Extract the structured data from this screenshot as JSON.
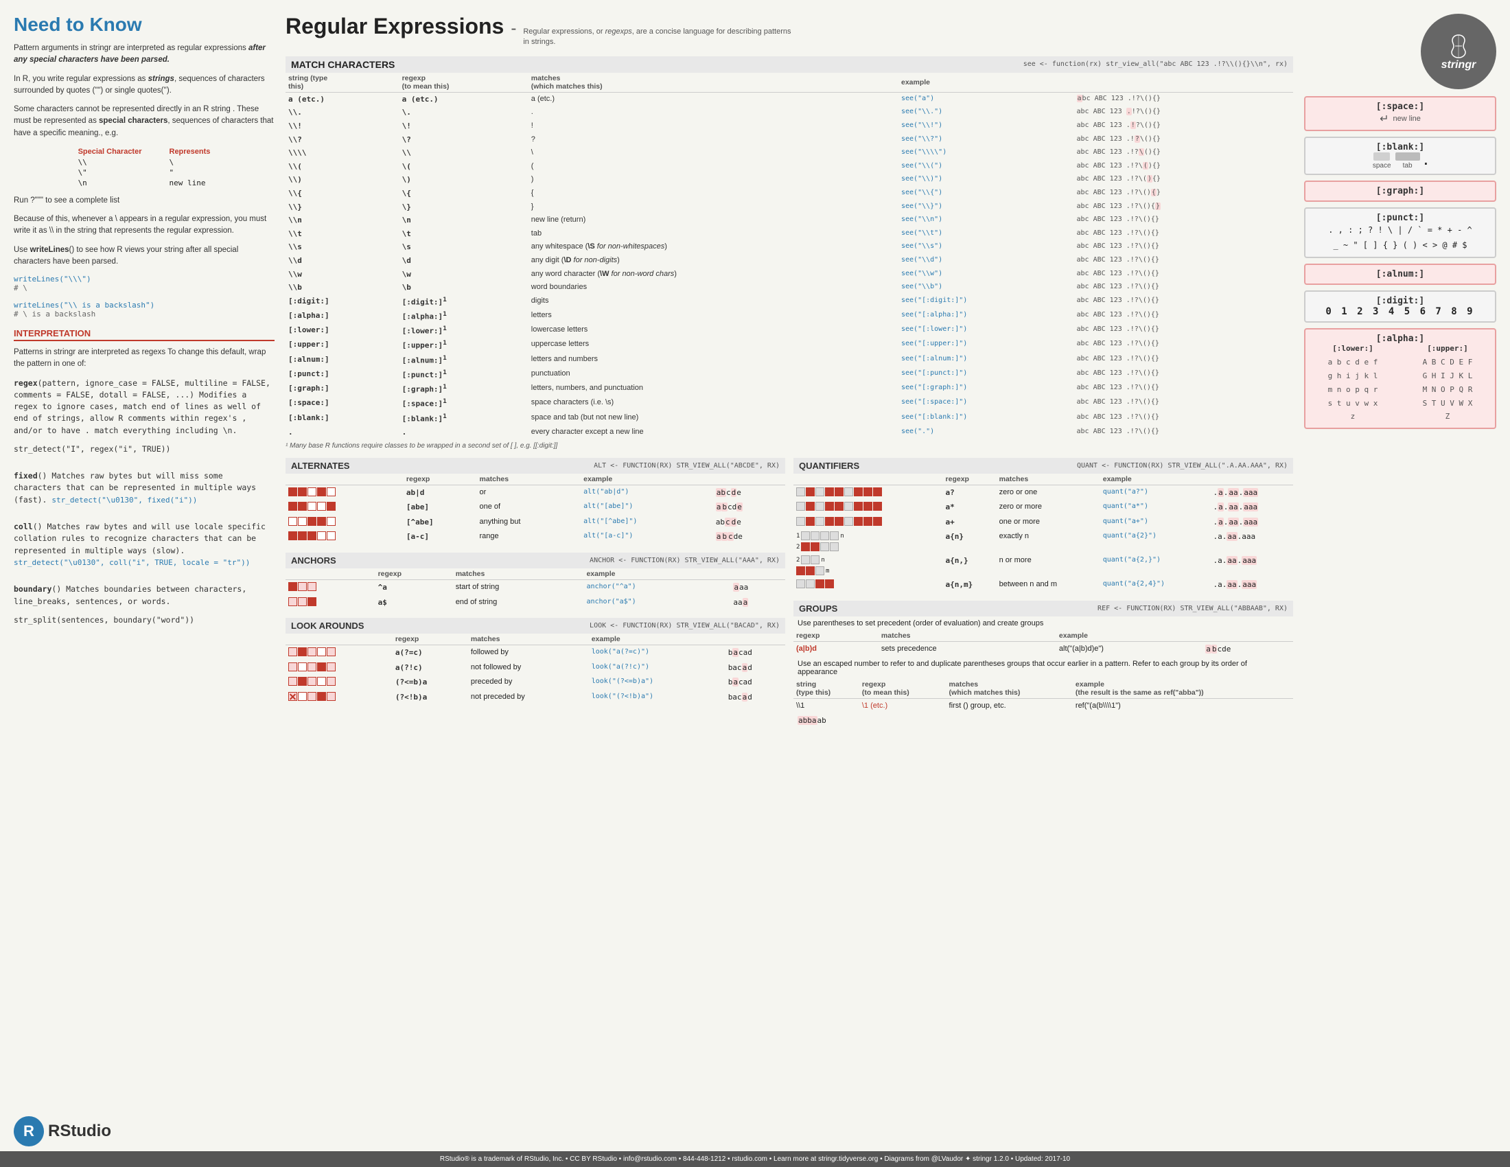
{
  "left": {
    "title": "Need to Know",
    "para1": "Pattern arguments in stringr are interpreted as regular expressions after any special characters have been parsed.",
    "para2": "In R, you write regular expressions as strings, sequences of characters surrounded by quotes (\"\") or single quotes('').",
    "para3": "Some characters cannot be represented directly in an R string . These must be represented as special characters, sequences of characters that have a specific meaning., e.g.",
    "special_chars_header": [
      "Special Character",
      "Represents"
    ],
    "special_chars": [
      {
        "char": "\\\\",
        "rep": "\\"
      },
      {
        "char": "\\\"",
        "rep": "\""
      },
      {
        "char": "\\n",
        "rep": "new line"
      }
    ],
    "run_code": "Run ?\"\"\" to see a complete list",
    "para4": "Because of this, whenever a \\ appears in a regular expression, you must write it as \\\\ in the string that represents the regular expression.",
    "para5": "Use writeLines() to see how R views your string after all special characters have been parsed.",
    "code1": "writeLines(\"\\\\\")\n# \\",
    "code2": "writeLines(\"\\\\ is a backslash\")\n# \\ is a backslash",
    "interpretation_title": "INTERPRETATION",
    "interp_para": "Patterns in stringr are interpreted as regexs To change this default, wrap the pattern in one of:",
    "regex_text": "regex(pattern, ignore_case = FALSE, multiline = FALSE, comments = FALSE, dotall = FALSE, ...) Modifies a regex to ignore cases, match end of lines as well of end of strings, allow R comments within regex's , and/or to have . match everything including \\n.\nstr_detect(\"I\", regex(\"i\", TRUE))",
    "fixed_text": "fixed() Matches raw bytes but will miss some characters that can be represented in multiple ways (fast). str_detect(\"\\u0130\", fixed(\"i\"))",
    "coll_text": "coll() Matches raw bytes and will use locale specific collation rules to recognize characters that can be represented in multiple ways (slow). str_detect(\"\\u0130\", coll(\"i\", TRUE, locale = \"tr\"))",
    "boundary_text": "boundary() Matches boundaries between characters, line_breaks, sentences, or words.\nstr_split(sentences, boundary(\"word\"))"
  },
  "middle": {
    "title": "Regular Expressions",
    "dash": "-",
    "subtitle": "Regular expressions, or regexps, are a concise language for describing patterns in strings.",
    "match_chars": {
      "header": "MATCH CHARACTERS",
      "see_fn": "see <- function(rx) str_view_all(\"abc ABC 123 .!?\\\\(){}\\n\", rx)",
      "col_headers": [
        "string (type this)",
        "regexp (to mean this)",
        "matches (which matches this)",
        "example"
      ],
      "rows": [
        {
          "string": "a (etc.)",
          "regexp": "a (etc.)",
          "matches": "a (etc.)",
          "see": "see(\"a\")",
          "example": "abc ABC 123 .!?\\(){}"
        },
        {
          "string": "\\\\.",
          "regexp": "\\.",
          "matches": ".",
          "see": "see(\"\\\\.\")",
          "example": "abc ABC 123 .!?\\(){}"
        },
        {
          "string": "\\\\!",
          "regexp": "\\!",
          "matches": "!",
          "see": "see(\"\\\\!\")",
          "example": "abc ABC 123 .!?\\(){}"
        },
        {
          "string": "\\\\?",
          "regexp": "\\?",
          "matches": "?",
          "see": "see(\"\\\\?\")",
          "example": "abc ABC 123 .!?\\(){}"
        },
        {
          "string": "\\\\\\\\",
          "regexp": "\\\\",
          "matches": "\\",
          "see": "see(\"\\\\\\\\\")",
          "example": "abc ABC 123 .!?\\(){}"
        },
        {
          "string": "\\\\(",
          "regexp": "\\(",
          "matches": "(",
          "see": "see(\"\\\\(\")",
          "example": "abc ABC 123 .!?\\(){}"
        },
        {
          "string": "\\\\)",
          "regexp": "\\)",
          "matches": ")",
          "see": "see(\"\\\\)\")",
          "example": "abc ABC 123 .!?\\(){}"
        },
        {
          "string": "\\\\{",
          "regexp": "\\{",
          "matches": "{",
          "see": "see(\"\\\\{\")",
          "example": "abc ABC 123 .!?\\(){}"
        },
        {
          "string": "\\\\}",
          "regexp": "\\}",
          "matches": "}",
          "see": "see(\"\\\\}\")",
          "example": "abc ABC 123 .!?\\(){}"
        },
        {
          "string": "\\\\n",
          "regexp": "\\n",
          "matches": "new line (return)",
          "see": "see(\"\\\\n\")",
          "example": "abc ABC 123 .!?\\(){}"
        },
        {
          "string": "\\\\t",
          "regexp": "\\t",
          "matches": "tab",
          "see": "see(\"\\\\t\")",
          "example": "abc ABC 123 .!?\\(){}"
        },
        {
          "string": "\\\\s",
          "regexp": "\\s",
          "matches": "any whitespace (\\S for non-whitespaces)",
          "see": "see(\"\\\\s\")",
          "example": "abc ABC 123 .!?\\(){}"
        },
        {
          "string": "\\\\d",
          "regexp": "\\d",
          "matches": "any digit (\\D for non-digits)",
          "see": "see(\"\\\\d\")",
          "example": "abc ABC 123 .!?\\(){}"
        },
        {
          "string": "\\\\w",
          "regexp": "\\w",
          "matches": "any word character (\\W for non-word chars)",
          "see": "see(\"\\\\w\")",
          "example": "abc ABC 123 .!?\\(){}"
        },
        {
          "string": "\\\\b",
          "regexp": "\\b",
          "matches": "word boundaries",
          "see": "see(\"\\\\b\")",
          "example": "abc ABC 123 .!?\\(){}"
        },
        {
          "string": "[:digit:]",
          "regexp": "[:digit:]",
          "matches": "digits",
          "see": "see(\"[:digit:]\")",
          "example": "abc ABC 123 .!?\\(){}"
        },
        {
          "string": "[:alpha:]",
          "regexp": "[:alpha:]",
          "matches": "letters",
          "see": "see(\"[:alpha:]\")",
          "example": "abc ABC 123 .!?\\(){}"
        },
        {
          "string": "[:lower:]",
          "regexp": "[:lower:]",
          "matches": "lowercase letters",
          "see": "see(\"[:lower:]\")",
          "example": "abc ABC 123 .!?\\(){}"
        },
        {
          "string": "[:upper:]",
          "regexp": "[:upper:]",
          "matches": "uppercase letters",
          "see": "see(\"[:upper:]\")",
          "example": "abc ABC 123 .!?\\(){}"
        },
        {
          "string": "[:alnum:]",
          "regexp": "[:alnum:]",
          "matches": "letters and numbers",
          "see": "see(\"[:alnum:]\")",
          "example": "abc ABC 123 .!?\\(){}"
        },
        {
          "string": "[:punct:]",
          "regexp": "[:punct:]",
          "matches": "punctuation",
          "see": "see(\"[:punct:]\")",
          "example": "abc ABC 123 .!?\\(){}"
        },
        {
          "string": "[:graph:]",
          "regexp": "[:graph:]",
          "matches": "letters, numbers, and punctuation",
          "see": "see(\"[:graph:]\")",
          "example": "abc ABC 123 .!?\\(){}"
        },
        {
          "string": "[:space:]",
          "regexp": "[:space:]",
          "matches": "space characters (i.e. \\s)",
          "see": "see(\"[:space:]\")",
          "example": "abc ABC 123 .!?\\(){}"
        },
        {
          "string": "[:blank:]",
          "regexp": "[:blank:]",
          "matches": "space and tab (but not new line)",
          "see": "see(\"[:blank:]\")",
          "example": "abc ABC 123 .!?\\(){}"
        },
        {
          "string": ".",
          "regexp": ".",
          "matches": "every character except a new line",
          "see": "see(\".\")",
          "example": "abc ABC 123 .!?\\(){}"
        }
      ],
      "footnote": "¹ Many base R functions require classes to be wrapped in a second set of [ ], e.g. [[:digit:]]"
    },
    "alternates": {
      "header": "ALTERNATES",
      "see_fn": "alt <- function(rx) str_view_all(\"abcde\", rx)",
      "col_headers": [
        "regexp",
        "matches",
        "example",
        ""
      ],
      "rows": [
        {
          "regexp": "ab|d",
          "matches": "or",
          "example_fn": "alt(\"ab|d\")",
          "result": "abcde"
        },
        {
          "regexp": "[abe]",
          "matches": "one of",
          "example_fn": "alt(\"[abe]\")",
          "result": "abcde"
        },
        {
          "regexp": "[^abe]",
          "matches": "anything but",
          "example_fn": "alt(\"[^abe]\")",
          "result": "abcde"
        },
        {
          "regexp": "[a-c]",
          "matches": "range",
          "example_fn": "alt(\"[a-c]\")",
          "result": "abcde"
        }
      ]
    },
    "anchors": {
      "header": "ANCHORS",
      "see_fn": "anchor <- function(rx) str_view_all(\"aaa\", rx)",
      "col_headers": [
        "regexp",
        "matches",
        "example",
        ""
      ],
      "rows": [
        {
          "regexp": "^a",
          "matches": "start of string",
          "example_fn": "anchor(\"^a\")",
          "result": "aaa"
        },
        {
          "regexp": "a$",
          "matches": "end of string",
          "example_fn": "anchor(\"a$\")",
          "result": "aaa"
        }
      ]
    },
    "lookarounds": {
      "header": "LOOK AROUNDS",
      "see_fn": "look <- function(rx) str_view_all(\"bacad\", rx)",
      "col_headers": [
        "regexp",
        "matches",
        "example",
        ""
      ],
      "rows": [
        {
          "regexp": "a(?=c)",
          "matches": "followed by",
          "example_fn": "look(\"a(?=c)\")",
          "result": "bacad"
        },
        {
          "regexp": "a(?!c)",
          "matches": "not followed by",
          "example_fn": "look(\"a(?!c)\")",
          "result": "bacad"
        },
        {
          "regexp": "(?<=b)a",
          "matches": "preceded by",
          "example_fn": "look(\"(?<=b)a\")",
          "result": "bacad"
        },
        {
          "regexp": "(?<!b)a",
          "matches": "not preceded by",
          "example_fn": "look(\"(?<!b)a\")",
          "result": "bacad"
        }
      ]
    },
    "quantifiers": {
      "header": "QUANTIFIERS",
      "see_fn": "quant <- function(rx) str_view_all(\".a.aa.aaa\", rx)",
      "col_headers": [
        "regexp",
        "matches",
        "example",
        ""
      ],
      "rows": [
        {
          "regexp": "a?",
          "matches": "zero or one",
          "example_fn": "quant(\"a?\")",
          "result": ".a.aa.aaa"
        },
        {
          "regexp": "a*",
          "matches": "zero or more",
          "example_fn": "quant(\"a*\")",
          "result": ".a.aa.aaa"
        },
        {
          "regexp": "a+",
          "matches": "one or more",
          "example_fn": "quant(\"a+\")",
          "result": ".a.aa.aaa"
        },
        {
          "regexp": "a{n}",
          "matches": "exactly n",
          "example_fn": "quant(\"a{2}\")",
          "result": ".a.aa.aaa"
        },
        {
          "regexp": "a{n,}",
          "matches": "n or more",
          "example_fn": "quant(\"a{2,}\")",
          "result": ".a.aa.aaa"
        },
        {
          "regexp": "a{n,m}",
          "matches": "between n and m",
          "example_fn": "quant(\"a{2,4}\")",
          "result": ".a.aa.aaa"
        }
      ]
    },
    "groups": {
      "header": "GROUPS",
      "see_fn": "ref <- function(rx) str_view_all(\"abbaab\", rx)",
      "desc": "Use parentheses to set precedent (order of evaluation) and create groups",
      "col_headers": [
        "regexp",
        "matches",
        "example"
      ],
      "rows": [
        {
          "regexp": "(a|b)d",
          "matches": "sets precedence",
          "example_fn": "alt(\"(a|b)d)e\")",
          "result": "abcde"
        }
      ],
      "desc2": "Use an escaped number to refer to and duplicate parentheses groups that occur earlier in a pattern. Refer to each group by its order of appearance",
      "col_headers2": [
        "string (type this)",
        "regexp (to mean this)",
        "matches (which matches this)",
        "example (the result is the same as ref(\"abba\"))"
      ],
      "rows2": [
        {
          "string": "\\\\1",
          "regexp": "\\1 (etc.)",
          "matches": "first () group, etc.",
          "example_fn": "ref(\"(a(b\\\\\\\\1\")",
          "result": "abbaab"
        }
      ]
    }
  },
  "right": {
    "space_class": {
      "title": "[:space:]",
      "newline_label": "↵ new line"
    },
    "blank_class": {
      "title": "[:blank:]",
      "space_label": "space",
      "tab_label": "tab",
      "dot_label": "."
    },
    "graph_class": {
      "title": "[:graph:]"
    },
    "punct_class": {
      "title": "[:punct:]",
      "chars1": ". , : ; ? ! \\ | / ` = * + - ^",
      "chars2": "_ ~ \" [ ] { } ( ) < > @ # $"
    },
    "alnum_class": {
      "title": "[:alnum:]"
    },
    "digit_class": {
      "title": "[:digit:]",
      "digits": "0 1 2 3 4 5 6 7 8 9"
    },
    "alpha_class": {
      "title": "[:alpha:]",
      "lower_title": "[:lower:]",
      "upper_title": "[:upper:]",
      "lower_letters": [
        "a b c d e f",
        "g h i j k l",
        "m n o p q r",
        "s t u v w x",
        "z"
      ],
      "upper_letters": [
        "A B C D E F",
        "G H I J K L",
        "M N O P Q R",
        "S T U V W X",
        "Z"
      ]
    }
  },
  "footer": {
    "text": "RStudio® is a trademark of RStudio, Inc.  •  CC BY RStudio  •  info@rstudio.com  •  844-448-1212  •  rstudio.com  •  Learn more at stringr.tidyverse.org  •  Diagrams from @LVaudor ✦  stringr 1.2.0  •  Updated: 2017-10"
  }
}
